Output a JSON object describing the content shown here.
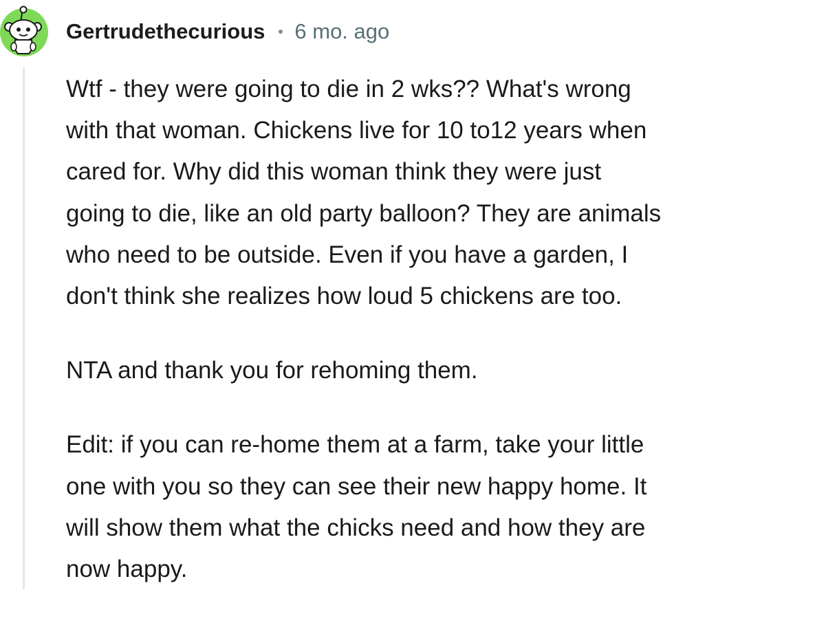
{
  "comment": {
    "username": "Gertrudethecurious",
    "separator": "•",
    "time_ago": "6 mo. ago",
    "avatar_icon": "reddit-snoo-avatar-icon",
    "colors": {
      "avatar_bg": "#7ed957",
      "snoo_body": "#ffffff",
      "username": "#1c1c1c",
      "meta": "#576f76",
      "thread_line": "#e5e8ea"
    },
    "paragraphs": [
      {
        "lines": [
          "Wtf - they were going to die in 2 wks?? What's wrong",
          "with that woman. Chickens live for 10 to12 years when",
          "cared for. Why did this woman think they were just",
          "going to die, like an old party balloon? They are animals",
          "who need to be outside. Even if you have a garden, I",
          "don't think she realizes how loud 5 chickens are too."
        ]
      },
      {
        "lines": [
          "NTA and thank you for rehoming them."
        ]
      },
      {
        "lines": [
          "Edit: if you can re-home them at a farm, take your little",
          "one with you so they can see their new happy home. It",
          "will show them what the chicks need and how they are",
          "now happy."
        ]
      }
    ]
  }
}
